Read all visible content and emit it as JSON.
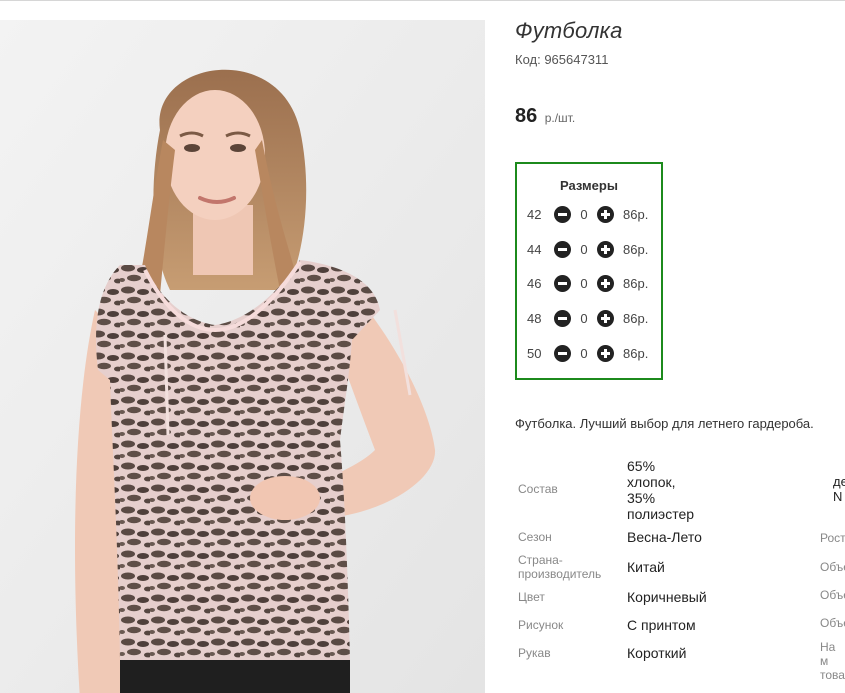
{
  "product": {
    "title": "Футболка",
    "code": "Код: 965647311",
    "price_value": "86",
    "price_unit": "р./шт."
  },
  "sizes": {
    "title": "Размеры",
    "rows": [
      {
        "size": "42",
        "qty": "0",
        "price": "86р."
      },
      {
        "size": "44",
        "qty": "0",
        "price": "86р."
      },
      {
        "size": "46",
        "qty": "0",
        "price": "86р."
      },
      {
        "size": "48",
        "qty": "0",
        "price": "86р."
      },
      {
        "size": "50",
        "qty": "0",
        "price": "86р."
      }
    ]
  },
  "description": "Футболка. Лучший выбор для летнего гардероба.",
  "specs": [
    {
      "label": "Состав",
      "value": "65%\nхлопок,\n35%\nполиэстер"
    },
    {
      "label": "Сезон",
      "value": "Весна-Лето"
    },
    {
      "label": "Страна-\nпроизводитель",
      "value": "Китай"
    },
    {
      "label": "Цвет",
      "value": "Коричневый"
    },
    {
      "label": "Рисунок",
      "value": "С принтом"
    },
    {
      "label": "Рукав",
      "value": "Короткий"
    }
  ],
  "specs_right": [
    {
      "value": "де\nN"
    },
    {
      "label": "Рост"
    },
    {
      "label": "Объе"
    },
    {
      "label": "Объе"
    },
    {
      "label": "Объе"
    },
    {
      "label": "На м\nтова"
    }
  ],
  "icons": {
    "minus": "minus-circle-icon",
    "plus": "plus-circle-icon"
  },
  "colors": {
    "size_box_border": "#1c8a1c",
    "button_fill": "#222222"
  }
}
